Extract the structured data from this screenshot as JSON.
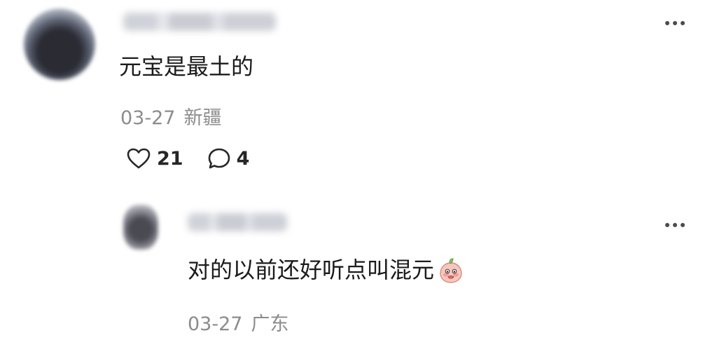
{
  "comment": {
    "text": "元宝是最土的",
    "date": "03-27",
    "location": "新疆",
    "likes": "21",
    "replies": "4",
    "more_icon": "more-dots-icon"
  },
  "reply": {
    "text": "对的以前还好听点叫混元",
    "date": "03-27",
    "location": "广东",
    "emoji_icon": "peach-blush-emoji",
    "more_icon": "more-dots-icon"
  },
  "colors": {
    "text": "#1b1b1b",
    "meta": "#8c8c8c",
    "icon": "#4b4b4b"
  }
}
